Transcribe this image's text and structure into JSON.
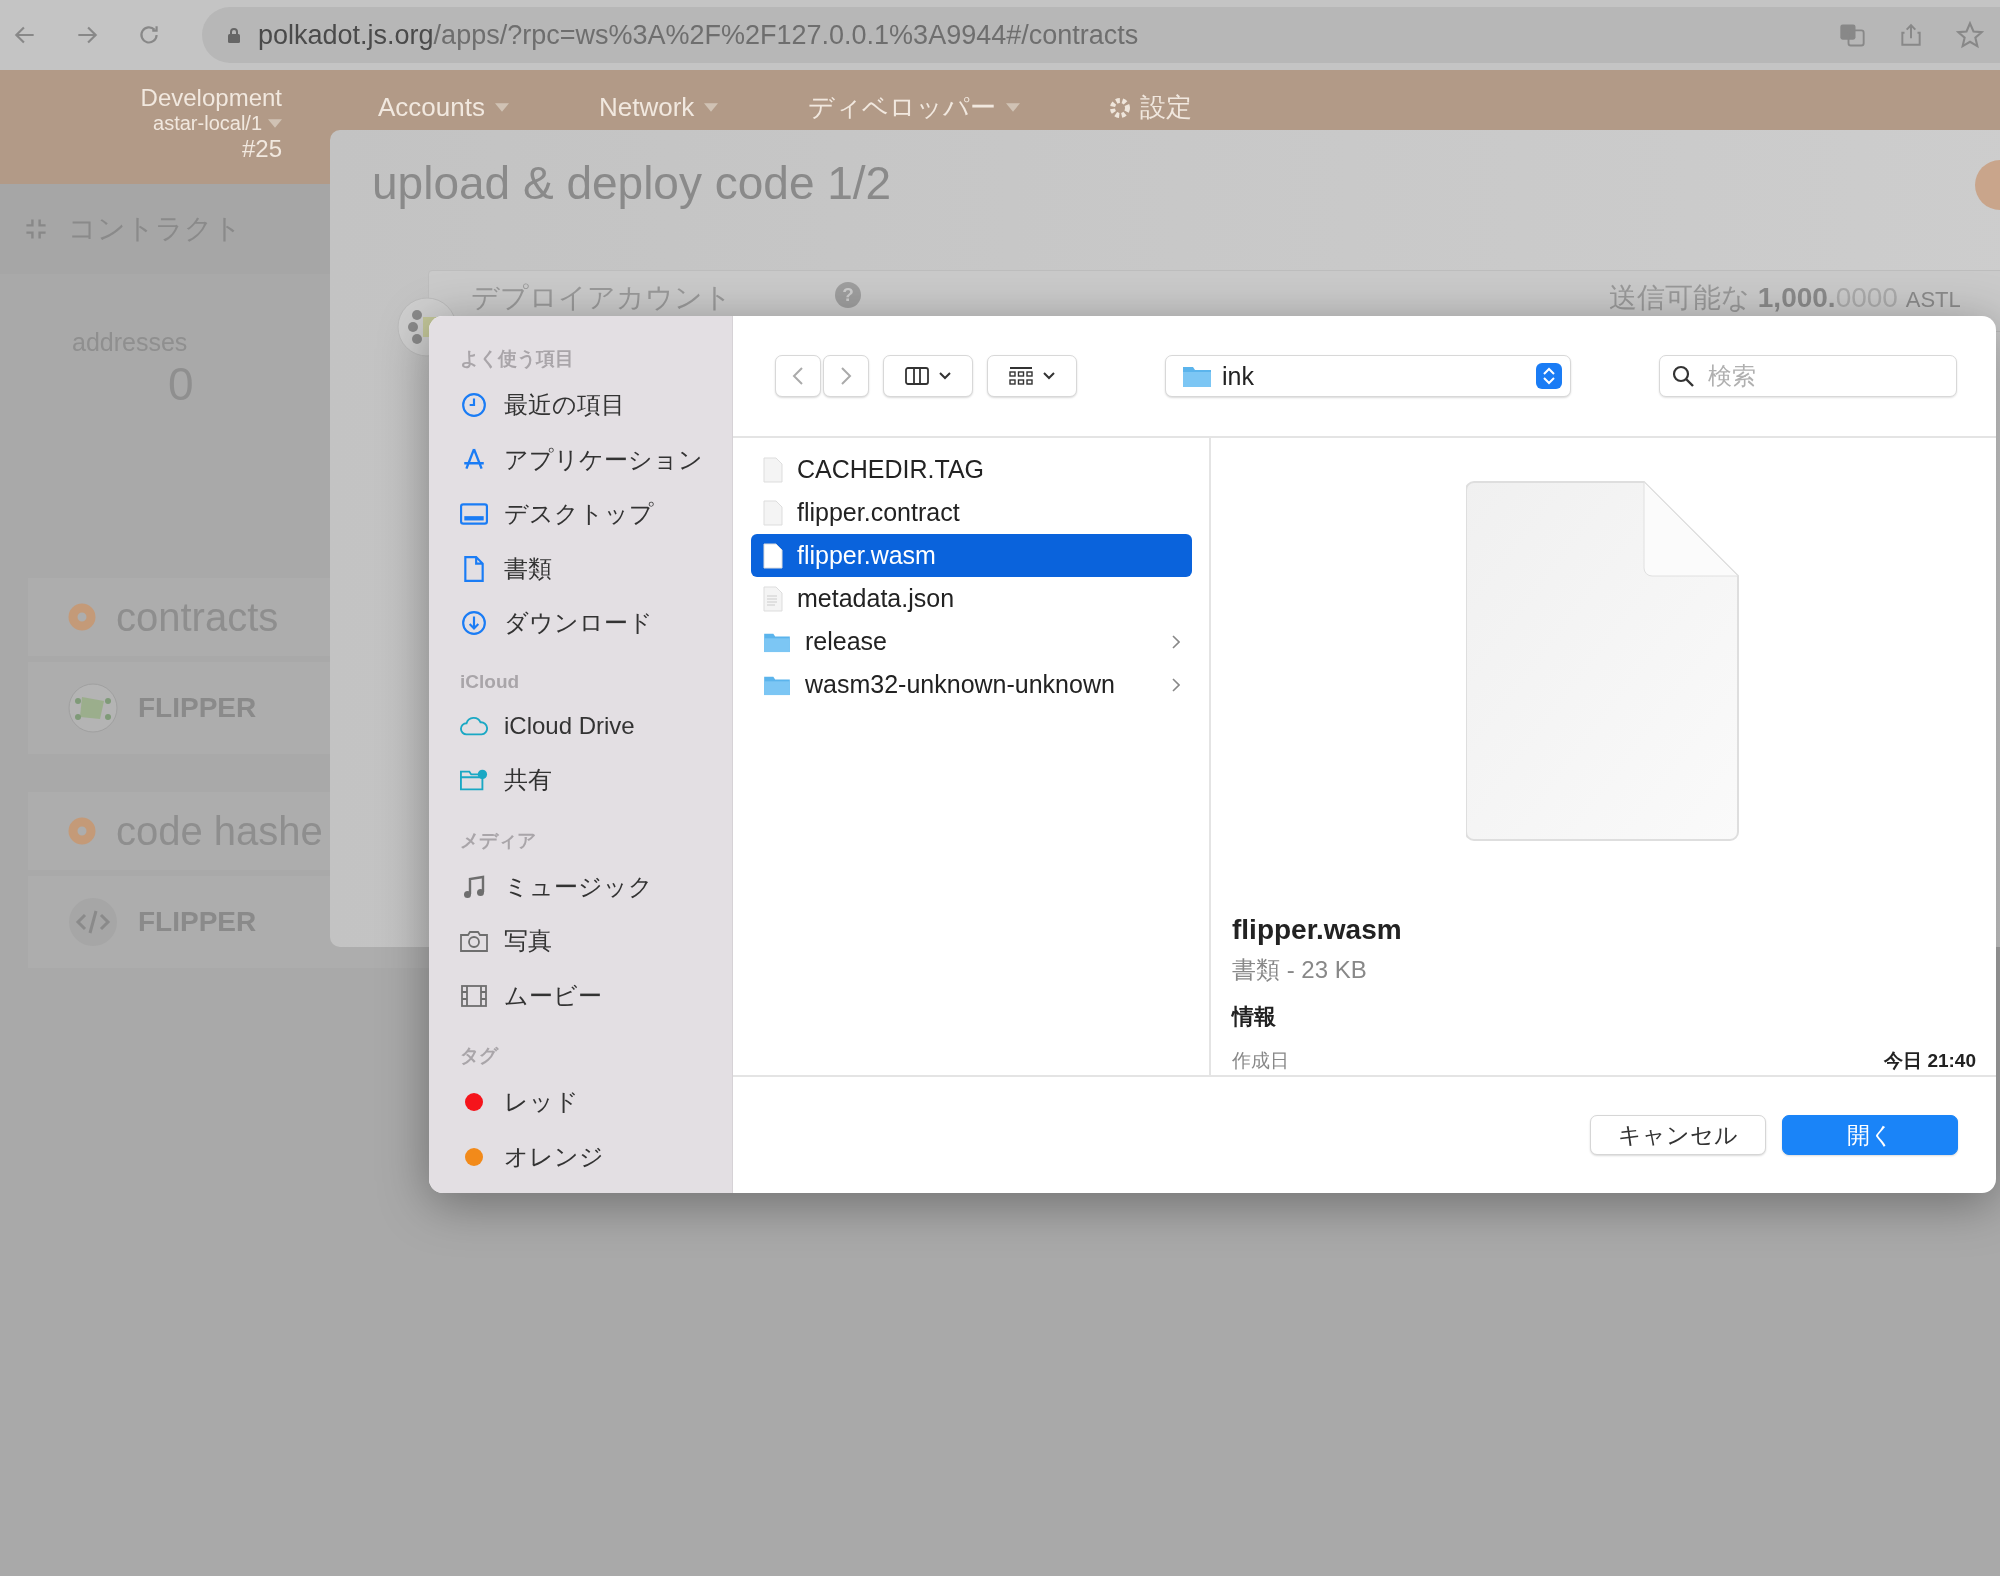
{
  "browser": {
    "url_host": "polkadot.js.org",
    "url_path": "/apps/?rpc=ws%3A%2F%2F127.0.0.1%3A9944#/contracts"
  },
  "header": {
    "chain": "Development",
    "network": "astar-local/1",
    "block": "#25",
    "nav": [
      {
        "label": "Accounts"
      },
      {
        "label": "Network"
      },
      {
        "label": "ディベロッパー"
      },
      {
        "label": "設定"
      }
    ]
  },
  "subnav": {
    "label": "コントラクト"
  },
  "summary": {
    "label": "addresses",
    "value": "0"
  },
  "sections": [
    {
      "title": "contracts",
      "items": [
        {
          "kind": "contract",
          "name": "FLIPPER"
        }
      ]
    },
    {
      "title": "code hashe",
      "items": [
        {
          "kind": "code",
          "name": "FLIPPER"
        }
      ]
    }
  ],
  "modal": {
    "title": "upload & deploy code 1/2",
    "account_label": "デプロイアカウント",
    "help": "?",
    "balance_label": "送信可能な",
    "balance_whole": "1,000.",
    "balance_fraction": "0000",
    "balance_unit": "ASTL"
  },
  "dialog": {
    "sidebar": [
      {
        "title": "よく使う項目",
        "items": [
          {
            "label": "最近の項目"
          },
          {
            "label": "アプリケーション"
          },
          {
            "label": "デスクトップ"
          },
          {
            "label": "書類"
          },
          {
            "label": "ダウンロード"
          }
        ]
      },
      {
        "title": "iCloud",
        "items": [
          {
            "label": "iCloud Drive"
          },
          {
            "label": "共有"
          }
        ]
      },
      {
        "title": "メディア",
        "items": [
          {
            "label": "ミュージック"
          },
          {
            "label": "写真"
          },
          {
            "label": "ムービー"
          }
        ]
      },
      {
        "title": "タグ",
        "items": [
          {
            "label": "レッド",
            "color": "#f5141b"
          },
          {
            "label": "オレンジ",
            "color": "#f28a1a"
          }
        ]
      }
    ],
    "location": "ink",
    "search": {
      "placeholder": "検索"
    },
    "files": [
      {
        "name": "CACHEDIR.TAG",
        "kind": "file",
        "selected": false
      },
      {
        "name": "flipper.contract",
        "kind": "file",
        "selected": false
      },
      {
        "name": "flipper.wasm",
        "kind": "file",
        "selected": true
      },
      {
        "name": "metadata.json",
        "kind": "text",
        "selected": false
      },
      {
        "name": "release",
        "kind": "folder",
        "selected": false
      },
      {
        "name": "wasm32-unknown-unknown",
        "kind": "folder",
        "selected": false
      }
    ],
    "preview": {
      "name": "flipper.wasm",
      "meta": "書類 - 23 KB",
      "info_heading": "情報",
      "created_label": "作成日",
      "created_value": "今日 21:40"
    },
    "buttons": [
      {
        "label": "キャンセル",
        "kind": "secondary"
      },
      {
        "label": "開く",
        "kind": "primary"
      }
    ]
  }
}
